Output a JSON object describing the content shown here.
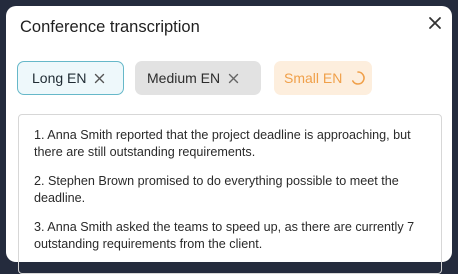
{
  "dialog": {
    "title": "Conference transcription",
    "close_icon": "close-icon"
  },
  "chips": [
    {
      "label": "Long EN",
      "state": "selected",
      "icon": "close-icon"
    },
    {
      "label": "Medium EN",
      "state": "default",
      "icon": "close-icon"
    },
    {
      "label": "Small EN",
      "state": "loading",
      "icon": "spinner-icon"
    }
  ],
  "transcript": {
    "items": [
      "1. Anna Smith reported that the project deadline is approaching, but there are still outstanding requirements.",
      "2. Stephen Brown promised to do everything possible to meet the deadline.",
      "3. Anna Smith asked the teams to speed up, as there are currently 7 outstanding requirements from the client."
    ]
  },
  "colors": {
    "background": "#242b3d",
    "selected_border": "#66b8c9",
    "loading_accent": "#f0a04a"
  }
}
